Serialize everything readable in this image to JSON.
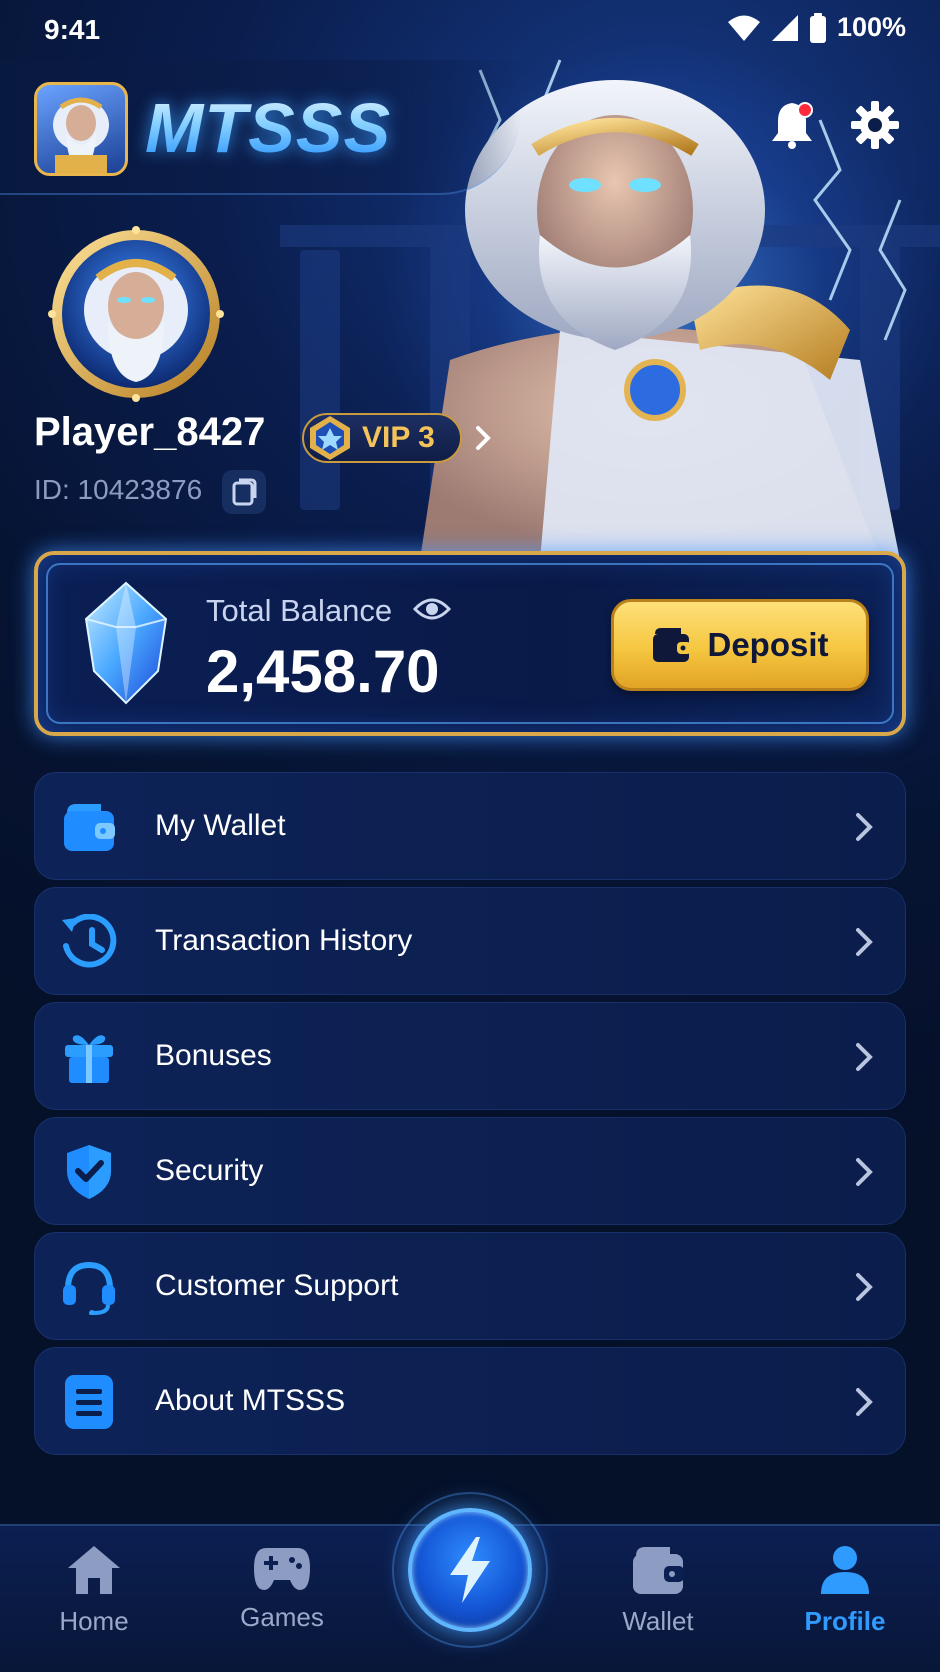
{
  "status_bar": {
    "time": "9:41",
    "battery": "100%"
  },
  "header": {
    "brand": "MTSSS",
    "notification_dot": true
  },
  "profile": {
    "username": "Player_8427",
    "vip": "VIP 3",
    "id_text": "ID: 10423876"
  },
  "balance": {
    "label": "Total Balance",
    "value": "2,458.70",
    "deposit_label": "Deposit"
  },
  "menu": [
    {
      "label": "My Wallet",
      "icon": "wallet-icon"
    },
    {
      "label": "Transaction History",
      "icon": "history-icon"
    },
    {
      "label": "Bonuses",
      "icon": "gift-icon"
    },
    {
      "label": "Security",
      "icon": "shield-icon"
    },
    {
      "label": "Customer Support",
      "icon": "headset-icon"
    },
    {
      "label": "About MTSSS",
      "icon": "document-icon"
    }
  ],
  "nav": [
    {
      "label": "Home",
      "icon": "home-icon",
      "active": false
    },
    {
      "label": "Games",
      "icon": "gamepad-icon",
      "active": false
    },
    {
      "label": "",
      "icon": "lightning-icon",
      "active": false
    },
    {
      "label": "Wallet",
      "icon": "wallet-icon",
      "active": false
    },
    {
      "label": "Profile",
      "icon": "user-icon",
      "active": true
    }
  ],
  "colors": {
    "accent": "#2f9bff",
    "gold": "#e8b64d",
    "background": "#06112e",
    "notification": "#ff2b3d"
  }
}
